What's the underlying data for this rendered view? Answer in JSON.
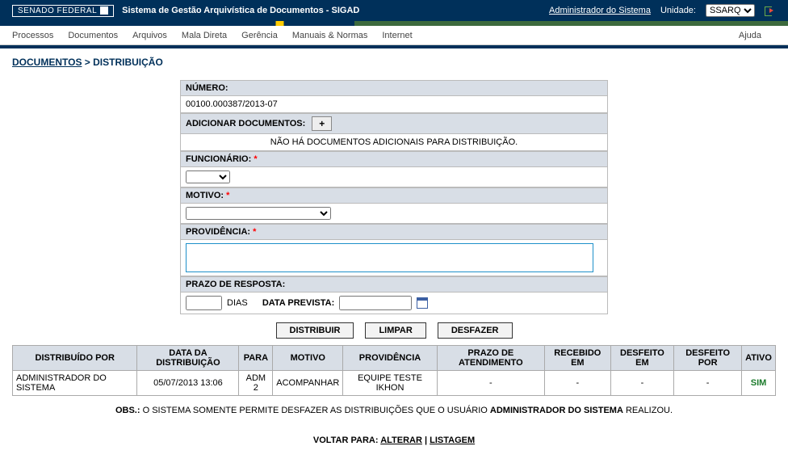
{
  "topbar": {
    "senado_label": "SENADO FEDERAL",
    "system_title": "Sistema de Gestão Arquivística de Documentos - SIGAD",
    "admin_link": "Administrador do Sistema",
    "unidade_label": "Unidade:",
    "unidade_value": "SSARQ"
  },
  "menu": {
    "items": [
      "Processos",
      "Documentos",
      "Arquivos",
      "Mala Direta",
      "Gerência",
      "Manuais & Normas",
      "Internet"
    ],
    "help": "Ajuda"
  },
  "breadcrumb": {
    "documentos": "DOCUMENTOS",
    "separator": " > ",
    "distribuicao": "DISTRIBUIÇÃO"
  },
  "form": {
    "numero_label": "NÚMERO:",
    "numero_value": "00100.000387/2013-07",
    "adicionar_label": "ADICIONAR DOCUMENTOS:",
    "plus": "+",
    "no_docs_msg": "NÃO HÁ DOCUMENTOS ADICIONAIS PARA DISTRIBUIÇÃO.",
    "funcionario_label": "FUNCIONÁRIO:",
    "motivo_label": "MOTIVO:",
    "providencia_label": "PROVIDÊNCIA:",
    "prazo_label": "PRAZO DE RESPOSTA:",
    "dias_label": "DIAS",
    "data_prevista_label": "DATA PREVISTA:",
    "req": "*"
  },
  "actions": {
    "distribuir": "DISTRIBUIR",
    "limpar": "LIMPAR",
    "desfazer": "DESFAZER"
  },
  "history": {
    "headers": [
      "DISTRIBUÍDO POR",
      "DATA DA DISTRIBUIÇÃO",
      "PARA",
      "MOTIVO",
      "PROVIDÊNCIA",
      "PRAZO DE ATENDIMENTO",
      "RECEBIDO EM",
      "DESFEITO EM",
      "DESFEITO POR",
      "ATIVO"
    ],
    "row": {
      "distribuido_por": "ADMINISTRADOR DO SISTEMA",
      "data": "05/07/2013 13:06",
      "para": "ADM 2",
      "motivo": "ACOMPANHAR",
      "providencia": "EQUIPE TESTE IKHON",
      "prazo": "-",
      "recebido": "-",
      "desfeito_em": "-",
      "desfeito_por": "-",
      "ativo": "SIM"
    }
  },
  "obs": {
    "prefix": "OBS.:",
    "text1": " O SISTEMA SOMENTE PERMITE DESFAZER AS DISTRIBUIÇÕES QUE O USUÁRIO ",
    "bold": "ADMINISTRADOR DO SISTEMA",
    "text2": " REALIZOU."
  },
  "voltar": {
    "label": "VOLTAR PARA:",
    "alterar": "ALTERAR",
    "sep": " | ",
    "listagem": "LISTAGEM"
  }
}
